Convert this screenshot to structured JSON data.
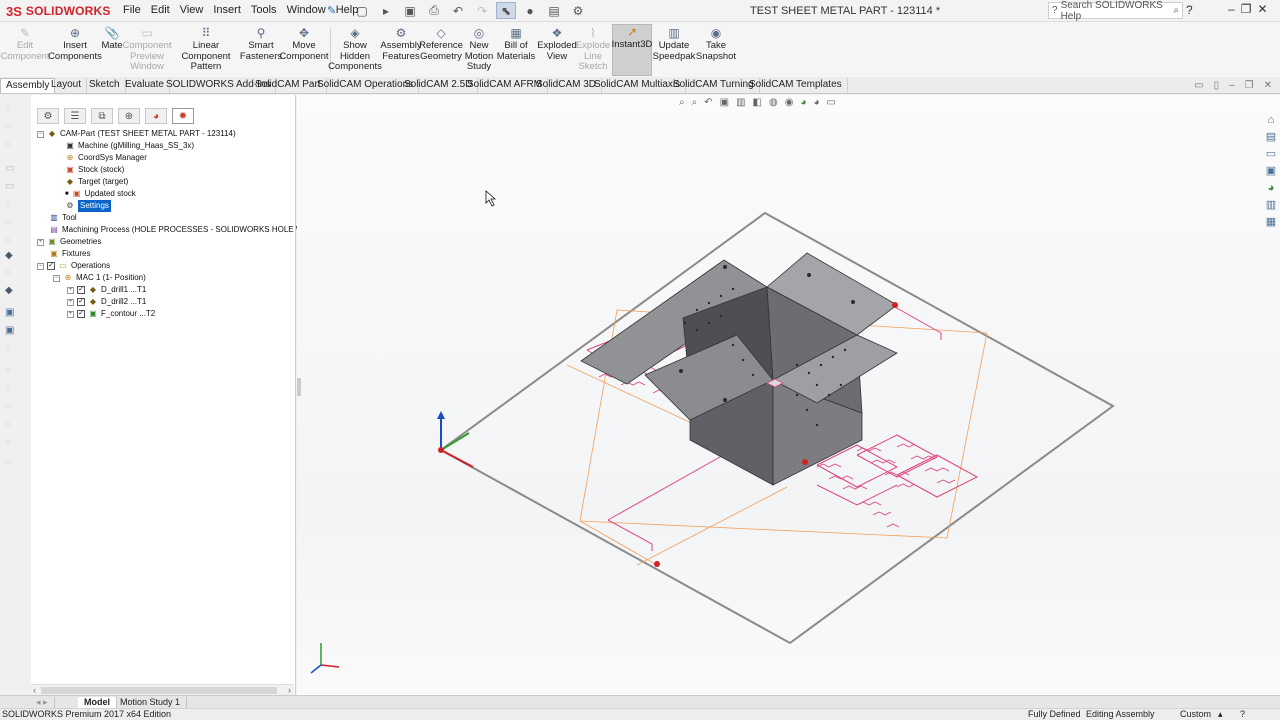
{
  "app": {
    "brand": "SOLIDWORKS",
    "document_title": "TEST SHEET METAL PART - 123114 *",
    "menus": [
      "File",
      "Edit",
      "View",
      "Insert",
      "Tools",
      "Window",
      "Help"
    ],
    "search_placeholder": "Search SOLIDWORKS Help"
  },
  "commands": [
    {
      "label": "Edit\nComponent",
      "icon": "edit-component-icon",
      "enabled": false
    },
    {
      "label": "Insert\nComponents",
      "icon": "insert-components-icon",
      "enabled": true
    },
    {
      "label": "Mate",
      "icon": "mate-icon",
      "enabled": true
    },
    {
      "label": "Component\nPreview\nWindow",
      "icon": "component-preview-icon",
      "enabled": false
    },
    {
      "label": "Linear Component\nPattern",
      "icon": "linear-pattern-icon",
      "enabled": true
    },
    {
      "label": "Smart\nFasteners",
      "icon": "smart-fasteners-icon",
      "enabled": true
    },
    {
      "label": "Move\nComponent",
      "icon": "move-component-icon",
      "enabled": true
    },
    {
      "label": "Show\nHidden\nComponents",
      "icon": "show-hidden-icon",
      "enabled": true
    },
    {
      "label": "Assembly\nFeatures",
      "icon": "assembly-features-icon",
      "enabled": true
    },
    {
      "label": "Reference\nGeometry",
      "icon": "reference-geometry-icon",
      "enabled": true
    },
    {
      "label": "New\nMotion\nStudy",
      "icon": "motion-study-icon",
      "enabled": true
    },
    {
      "label": "Bill of\nMaterials",
      "icon": "bom-icon",
      "enabled": true
    },
    {
      "label": "Exploded\nView",
      "icon": "exploded-view-icon",
      "enabled": true
    },
    {
      "label": "Explode\nLine\nSketch",
      "icon": "explode-line-icon",
      "enabled": false
    },
    {
      "label": "Instant3D",
      "icon": "instant3d-icon",
      "enabled": true,
      "active": true
    },
    {
      "label": "Update\nSpeedpak",
      "icon": "speedpak-icon",
      "enabled": true
    },
    {
      "label": "Take\nSnapshot",
      "icon": "snapshot-icon",
      "enabled": true
    }
  ],
  "tabs": [
    "Assembly",
    "Layout",
    "Sketch",
    "Evaluate",
    "SOLIDWORKS Add-Ins",
    "SolidCAM Part",
    "SolidCAM Operations",
    "SolidCAM 2.5D",
    "SolidCAM AFRM",
    "SolidCAM 3D",
    "SolidCAM Multiaxis",
    "SolidCAM Turning",
    "SolidCAM Templates"
  ],
  "active_tab": "Assembly",
  "tree": [
    {
      "label": "CAM-Part (TEST SHEET METAL PART - 123114)"
    },
    {
      "label": "Machine (gMilling_Haas_SS_3x)"
    },
    {
      "label": "CoordSys Manager"
    },
    {
      "label": "Stock (stock)"
    },
    {
      "label": "Target (target)"
    },
    {
      "label": "Updated stock"
    },
    {
      "label": "Settings"
    },
    {
      "label": "Tool"
    },
    {
      "label": "Machining Process (HOLE PROCESSES - SOLIDWORKS HOLE WIZARD - I"
    },
    {
      "label": "Geometries"
    },
    {
      "label": "Fixtures"
    },
    {
      "label": "Operations"
    },
    {
      "label": "MAC 1 (1- Position)"
    },
    {
      "label": "D_drill1 ...T1"
    },
    {
      "label": "D_drill2 ...T1"
    },
    {
      "label": "F_contour ...T2"
    }
  ],
  "bottom_tabs": [
    "Model",
    "Motion Study 1"
  ],
  "status": {
    "edition": "SOLIDWORKS Premium 2017 x64 Edition",
    "definition": "Fully Defined",
    "mode": "Editing Assembly",
    "units": "Custom"
  },
  "colors": {
    "brand_red": "#d2232a",
    "toolpath_pink": "#e0457a",
    "stock_orange": "#f0a05a",
    "part_gray": "#6b6d72",
    "selection_blue": "#0a64c8"
  }
}
